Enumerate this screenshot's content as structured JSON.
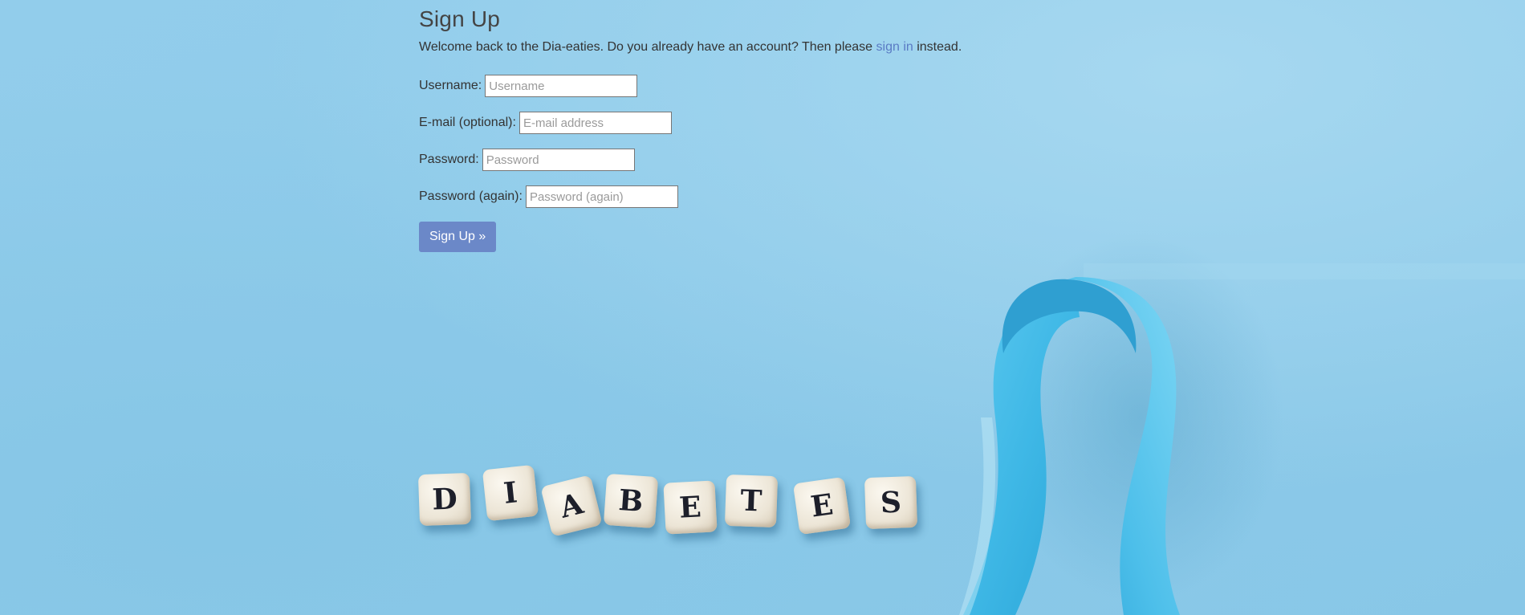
{
  "header": {
    "title": "Sign Up"
  },
  "intro": {
    "before_link": "Welcome back to the Dia-eaties. Do you already have an account? Then please ",
    "link_label": "sign in",
    "after_link": " instead."
  },
  "form": {
    "username": {
      "label": "Username:",
      "placeholder": "Username",
      "value": ""
    },
    "email": {
      "label": "E-mail (optional):",
      "placeholder": "E-mail address",
      "value": ""
    },
    "password": {
      "label": "Password:",
      "placeholder": "Password",
      "value": ""
    },
    "password_again": {
      "label": "Password (again):",
      "placeholder": "Password (again)",
      "value": ""
    },
    "submit_label": "Sign Up »"
  },
  "background": {
    "dice_letters": [
      "D",
      "I",
      "A",
      "B",
      "E",
      "T",
      "E",
      "S"
    ],
    "ribbon_color": "#3fb8e6",
    "link_color": "#5a7bc4",
    "button_color": "#6b88c8"
  }
}
